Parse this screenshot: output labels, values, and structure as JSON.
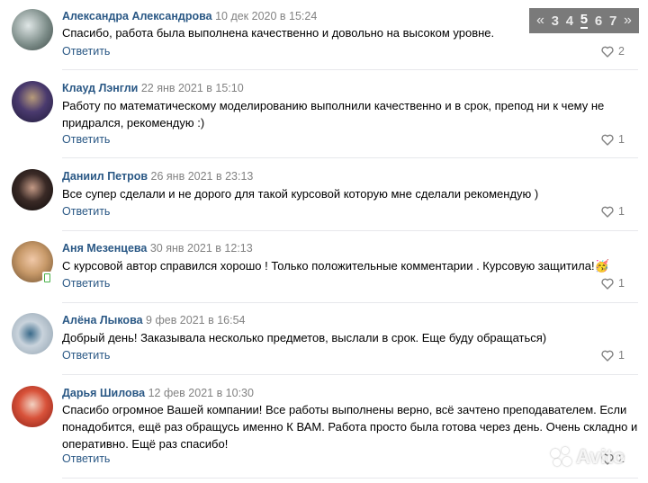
{
  "pagination": {
    "prev": "«",
    "pages": [
      "3",
      "4",
      "5",
      "6",
      "7"
    ],
    "current": "5",
    "next": "»"
  },
  "reply_label": "Ответить",
  "watermark": "Avito",
  "comments": [
    {
      "name": "Александра Александрова",
      "date": "10 дек 2020 в 15:24",
      "text": "Спасибо, работа была выполнена качественно и довольно на высоком уровне.",
      "likes": "2"
    },
    {
      "name": "Клауд Лэнгли",
      "date": "22 янв 2021 в 15:10",
      "text": "Работу по математическому моделированию выполнили качественно и в срок, препод ни к чему не придрался, рекомендую :)",
      "likes": "1"
    },
    {
      "name": "Даниил Петров",
      "date": "26 янв 2021 в 23:13",
      "text": "Все супер сделали и не дорого для такой курсовой которую мне сделали рекомендую )",
      "likes": "1"
    },
    {
      "name": "Аня Мезенцева",
      "date": "30 янв 2021 в 12:13",
      "text": "С курсовой автор справился хорошо ! Только положительные комментарии . Курсовую защитила!🥳",
      "likes": "1"
    },
    {
      "name": "Алёна Лыкова",
      "date": "9 фев 2021 в 16:54",
      "text": "Добрый день! Заказывала несколько предметов, выслали в срок. Еще буду обращаться)",
      "likes": "1"
    },
    {
      "name": "Дарья Шилова",
      "date": "12 фев 2021 в 10:30",
      "text": "Спасибо огромное Вашей компании! Все работы выполнены верно, всё зачтено преподавателем. Если понадобится, ещё раз обращусь именно К ВАМ. Работа просто была готова через день. Очень складно и оперативно. Ещё раз спасибо!",
      "likes": "2"
    }
  ],
  "colors": {
    "link": "#2a5885",
    "meta": "#828282",
    "divider": "#e7e8ec"
  }
}
